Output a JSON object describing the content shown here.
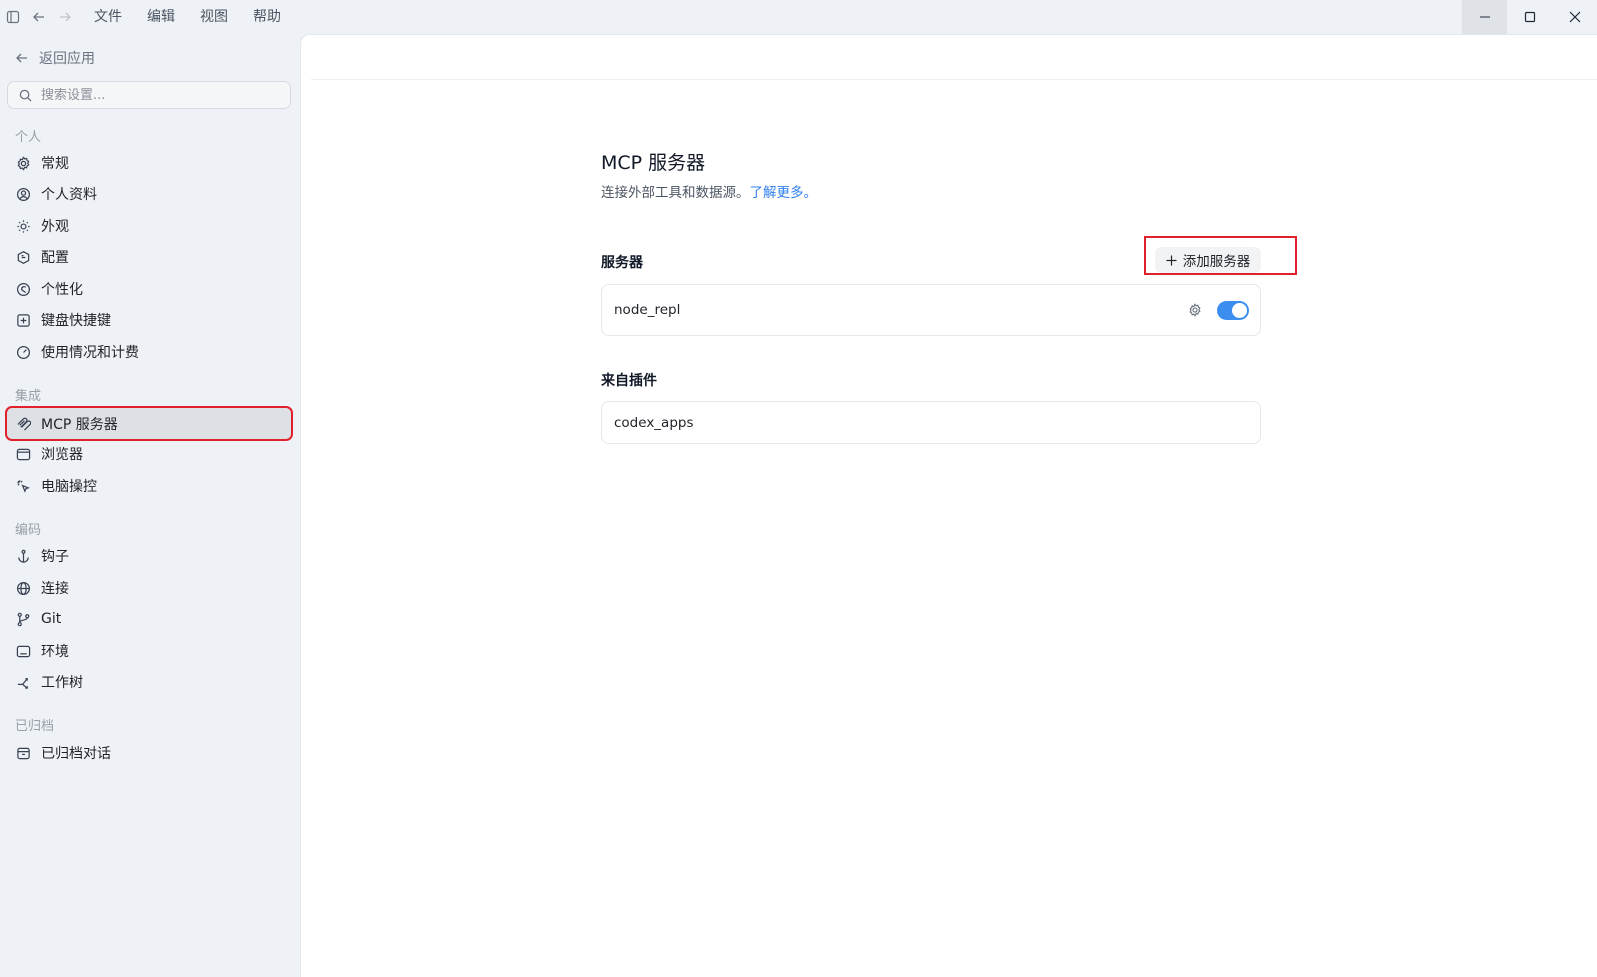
{
  "menu": [
    "文件",
    "编辑",
    "视图",
    "帮助"
  ],
  "sidebar": {
    "back_label": "返回应用",
    "search_placeholder": "搜索设置...",
    "sections": {
      "personal": "个人",
      "integration": "集成",
      "coding": "编码",
      "archived": "已归档"
    },
    "items": {
      "general": "常规",
      "profile": "个人资料",
      "appearance": "外观",
      "config": "配置",
      "personalize": "个性化",
      "shortcuts": "键盘快捷键",
      "usage": "使用情况和计费",
      "mcp": "MCP 服务器",
      "browser": "浏览器",
      "computer": "电脑操控",
      "hooks": "钩子",
      "connect": "连接",
      "git": "Git",
      "env": "环境",
      "worktree": "工作树",
      "archived_chats": "已归档对话"
    }
  },
  "main": {
    "title": "MCP 服务器",
    "description": "连接外部工具和数据源。",
    "learn_more": "了解更多。",
    "servers_heading": "服务器",
    "add_server_label": "添加服务器",
    "servers": [
      {
        "name": "node_repl",
        "enabled": true
      }
    ],
    "plugins_heading": "来自插件",
    "plugins": [
      {
        "name": "codex_apps"
      }
    ]
  },
  "colors": {
    "accent": "#3b8ef0",
    "link": "#2f80ed",
    "highlight": "#e0202a"
  }
}
